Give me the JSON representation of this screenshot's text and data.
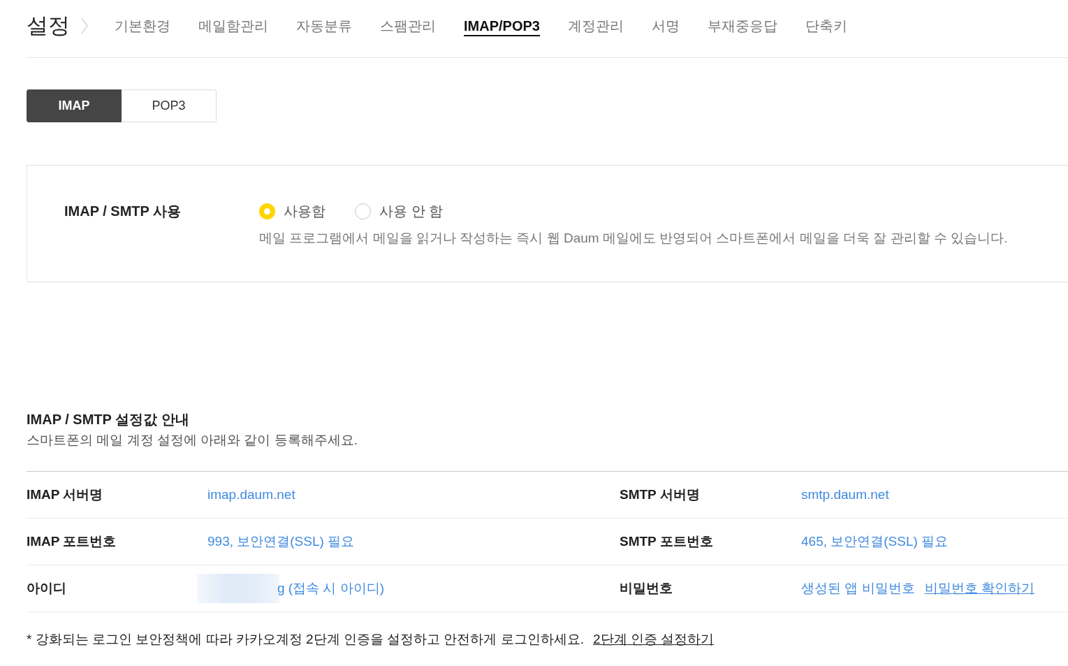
{
  "header": {
    "title": "설정",
    "tabs": [
      {
        "label": "기본환경",
        "selected": false
      },
      {
        "label": "메일함관리",
        "selected": false
      },
      {
        "label": "자동분류",
        "selected": false
      },
      {
        "label": "스팸관리",
        "selected": false
      },
      {
        "label": "IMAP/POP3",
        "selected": true
      },
      {
        "label": "계정관리",
        "selected": false
      },
      {
        "label": "서명",
        "selected": false
      },
      {
        "label": "부재중응답",
        "selected": false
      },
      {
        "label": "단축키",
        "selected": false
      }
    ]
  },
  "protocol_tabs": [
    {
      "label": "IMAP",
      "selected": true
    },
    {
      "label": "POP3",
      "selected": false
    }
  ],
  "usage_panel": {
    "label": "IMAP / SMTP 사용",
    "options": [
      {
        "label": "사용함",
        "selected": true
      },
      {
        "label": "사용 안 함",
        "selected": false
      }
    ],
    "description": "메일 프로그램에서 메일을 읽거나 작성하는 즉시 웹 Daum 메일에도 반영되어 스마트폰에서 메일을 더욱 잘 관리할 수 있습니다."
  },
  "settings_guide": {
    "title": "IMAP / SMTP 설정값 안내",
    "subtitle": "스마트폰의 메일 계정 설정에 아래와 같이 등록해주세요.",
    "rows": [
      {
        "cells": [
          {
            "label": "IMAP 서버명",
            "value": "imap.daum.net"
          },
          {
            "label": "SMTP 서버명",
            "value": "smtp.daum.net"
          }
        ]
      },
      {
        "cells": [
          {
            "label": "IMAP 포트번호",
            "value": "993, 보안연결(SSL) 필요"
          },
          {
            "label": "SMTP 포트번호",
            "value": "465, 보안연결(SSL) 필요"
          }
        ]
      },
      {
        "cells": [
          {
            "label": "아이디",
            "value": "g (접속 시 아이디)",
            "redacted": true
          },
          {
            "label": "비밀번호",
            "value": "생성된 앱 비밀번호",
            "link": "비밀번호 확인하기"
          }
        ]
      }
    ]
  },
  "notice": {
    "text": "* 강화되는 로그인 보안정책에 따라 카카오계정 2단계 인증을 설정하고 안전하게 로그인하세요.",
    "link": "2단계 인증 설정하기"
  }
}
